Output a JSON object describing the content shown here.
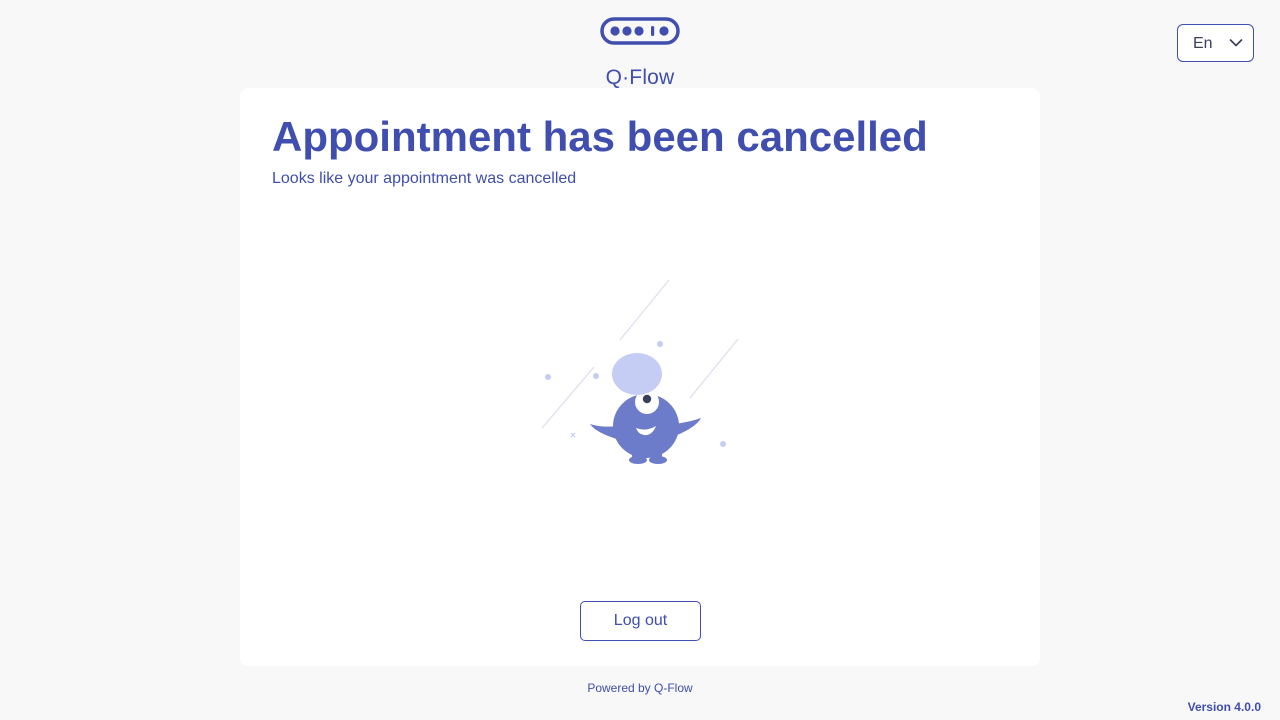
{
  "header": {
    "logo_text": "Q·Flow",
    "logo_icon": "q-flow-logo-icon"
  },
  "language_select": {
    "value": "En",
    "icon": "chevron-down-icon"
  },
  "card": {
    "title": "Appointment has been cancelled",
    "subtitle": "Looks like your appointment was cancelled",
    "illustration": "one-eyed-monster-illustration",
    "logout_label": "Log out"
  },
  "footer": {
    "powered_by": "Powered by Q-Flow",
    "version": "Version 4.0.0"
  },
  "colors": {
    "primary": "#3f4eaf",
    "background": "#f8f8f8",
    "card": "#ffffff",
    "illustration_body": "#6d7bcb",
    "illustration_light": "#c6cdf5"
  }
}
